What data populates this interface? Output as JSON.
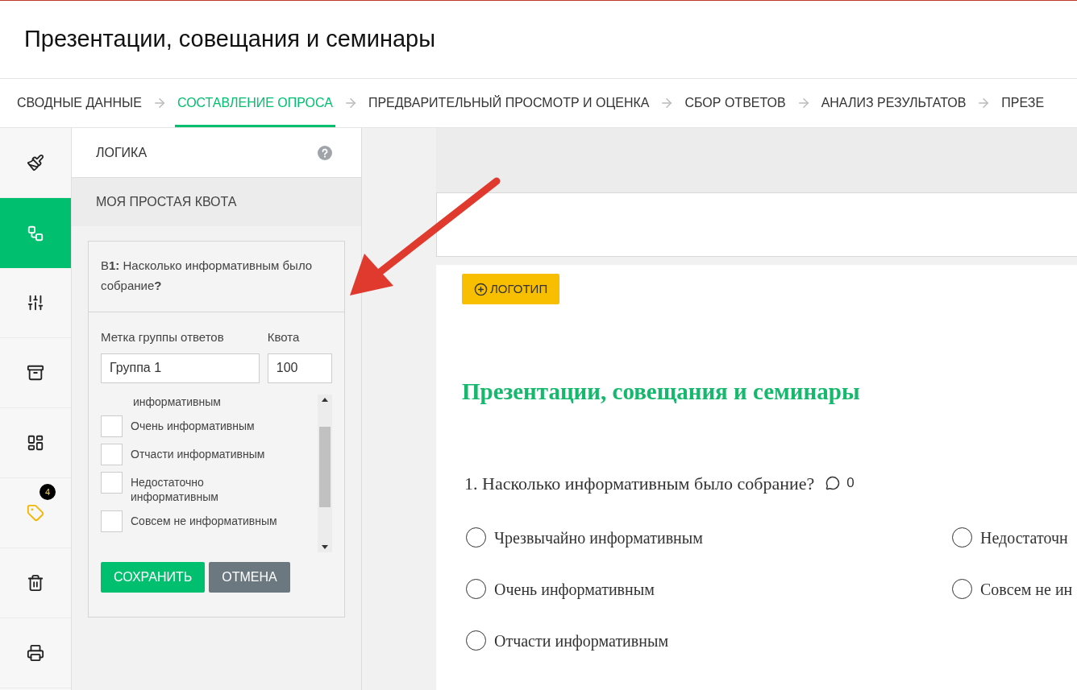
{
  "page_title": "Презентации, совещания и семинары",
  "steps": [
    {
      "label": "СВОДНЫЕ ДАННЫЕ",
      "selected": false
    },
    {
      "label": "СОСТАВЛЕНИЕ ОПРОСА",
      "selected": true
    },
    {
      "label": "ПРЕДВАРИТЕЛЬНЫЙ ПРОСМОТР И ОЦЕНКА",
      "selected": false
    },
    {
      "label": "СБОР ОТВЕТОВ",
      "selected": false
    },
    {
      "label": "АНАЛИЗ РЕЗУЛЬТАТОВ",
      "selected": false
    },
    {
      "label": "ПРЕЗЕ",
      "selected": false
    }
  ],
  "tools": [
    {
      "kind": "design",
      "selected": false
    },
    {
      "kind": "logic",
      "selected": true
    },
    {
      "kind": "options",
      "selected": false
    },
    {
      "kind": "library",
      "selected": false
    },
    {
      "kind": "layout",
      "selected": false
    },
    {
      "kind": "tags",
      "selected": false,
      "badge": "4"
    },
    {
      "kind": "trash",
      "selected": false
    },
    {
      "kind": "print",
      "selected": false
    }
  ],
  "panel": {
    "title": "ЛОГИКА",
    "subtitle": "МОЯ ПРОСТАЯ КВОТА",
    "question": "В**1:** Насколько информативным было собрание**?**",
    "group_label": "Метка группы ответов",
    "group_value": "Группа 1",
    "quota_label": "Квота",
    "quota_value": "100",
    "answers": [
      {
        "label": "информативным",
        "kind": "continuation"
      },
      {
        "label": "Очень информативным",
        "kind": "checkbox",
        "checked": false
      },
      {
        "label": "Отчасти информативным",
        "kind": "checkbox",
        "checked": false
      },
      {
        "label": "Недостаточно информативным",
        "kind": "checkbox",
        "checked": false
      },
      {
        "label": "Совсем не информативным",
        "kind": "checkbox",
        "checked": false
      }
    ],
    "buttons": [
      {
        "label": "СОХРАНИТЬ",
        "kind": "primary"
      },
      {
        "label": "ОТМЕНА",
        "kind": "secondary"
      }
    ]
  },
  "survey": {
    "logo_button": "ЛОГОТИП",
    "title": "Презентации, совещания и семинары",
    "question": "1. Насколько информативным было собрание?",
    "comment_count": "0",
    "options": [
      {
        "label": "Чрезвычайно информативным",
        "selected": false
      },
      {
        "label": "Недостаточн",
        "selected": false
      },
      {
        "label": "Очень информативным",
        "selected": false
      },
      {
        "label": "Совсем не ин",
        "selected": false
      },
      {
        "label": "Отчасти информативным",
        "selected": false
      }
    ]
  }
}
